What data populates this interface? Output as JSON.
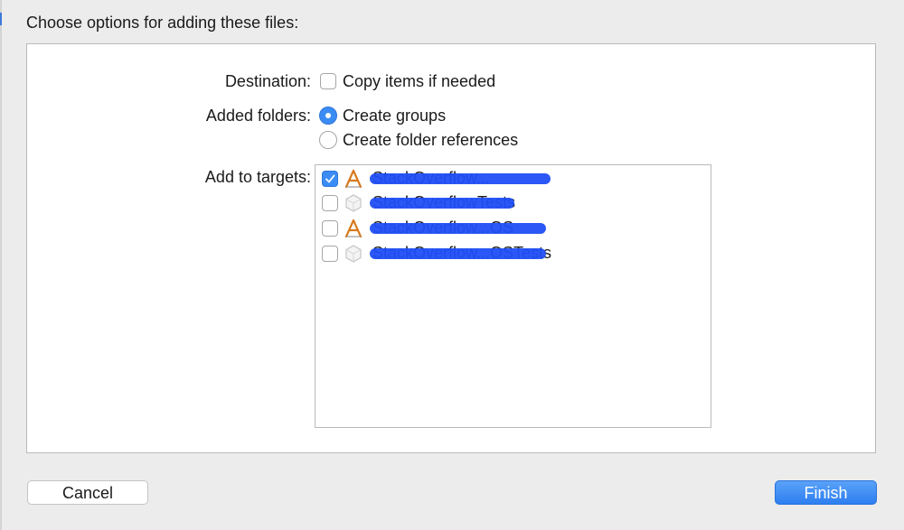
{
  "dialog": {
    "title": "Choose options for adding these files:"
  },
  "destination": {
    "label": "Destination:",
    "copy_items": {
      "label": "Copy items if needed",
      "checked": false
    }
  },
  "added_folders": {
    "label": "Added folders:",
    "options": [
      {
        "label": "Create groups",
        "selected": true
      },
      {
        "label": "Create folder references",
        "selected": false
      }
    ]
  },
  "targets": {
    "label": "Add to targets:",
    "items": [
      {
        "name": "StackOverflow...",
        "checked": true,
        "icon": "app-target-icon"
      },
      {
        "name": "StackOverflowTests",
        "checked": false,
        "icon": "test-bundle-icon"
      },
      {
        "name": "StackOverflow...OS",
        "checked": false,
        "icon": "app-target-icon"
      },
      {
        "name": "StackOverflow...OSTests",
        "checked": false,
        "icon": "test-bundle-icon"
      }
    ]
  },
  "buttons": {
    "cancel": "Cancel",
    "finish": "Finish"
  },
  "colors": {
    "accent": "#3b8cf5",
    "redaction": "#1f4ef5",
    "background": "#ececec"
  }
}
